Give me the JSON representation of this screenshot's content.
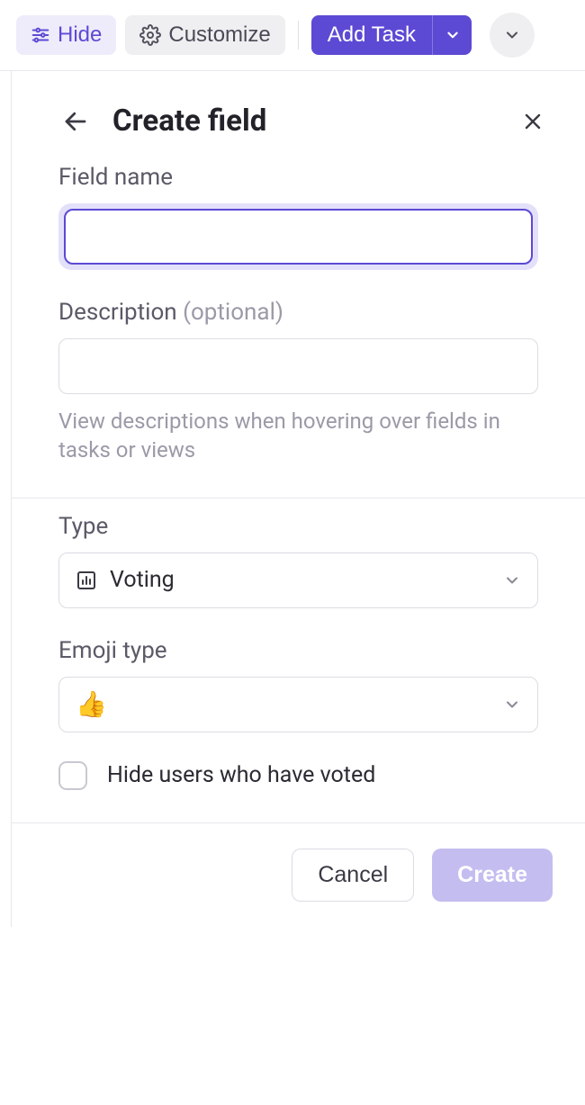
{
  "toolbar": {
    "hide_label": "Hide",
    "customize_label": "Customize",
    "add_task_label": "Add Task"
  },
  "panel": {
    "title": "Create field"
  },
  "form": {
    "field_name_label": "Field name",
    "field_name_value": "",
    "description_label": "Description ",
    "description_optional": "(optional)",
    "description_value": "",
    "description_helper": "View descriptions when hovering over fields in tasks or views",
    "type_label": "Type",
    "type_value": "Voting",
    "emoji_type_label": "Emoji type",
    "emoji_type_value": "👍",
    "hide_users_label": "Hide users who have voted",
    "hide_users_checked": false
  },
  "footer": {
    "cancel_label": "Cancel",
    "create_label": "Create"
  },
  "colors": {
    "primary": "#5c4ad4",
    "primary_light": "#c4bdf0",
    "primary_bg": "#eeecfb"
  }
}
